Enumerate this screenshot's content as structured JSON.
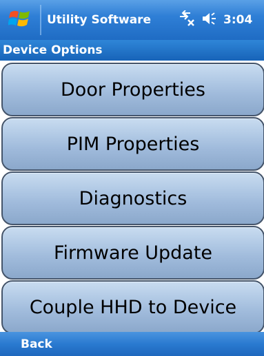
{
  "titlebar": {
    "app_title": "Utility Software",
    "clock": "3:04",
    "icons": [
      "windows-start-icon",
      "connectivity-icon",
      "volume-icon"
    ]
  },
  "section": {
    "title": "Device Options"
  },
  "menu": {
    "items": [
      {
        "label": "Door Properties"
      },
      {
        "label": "PIM Properties"
      },
      {
        "label": "Diagnostics"
      },
      {
        "label": "Firmware Update"
      },
      {
        "label": "Couple HHD to Device"
      }
    ]
  },
  "softkeys": {
    "left": "Back"
  },
  "colors": {
    "titlebar": "#2f7fd6",
    "button_fill": "#b3cbe6",
    "button_border": "#44546a"
  }
}
